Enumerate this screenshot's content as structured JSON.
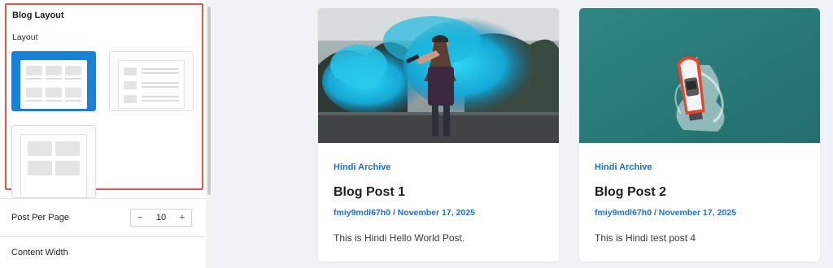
{
  "sidebar": {
    "section_title": "Blog Layout",
    "layout_label": "Layout",
    "layout_options": [
      "grid",
      "list",
      "masonry"
    ],
    "selected_layout": "grid",
    "post_per_page": {
      "label": "Post Per Page",
      "value": "10",
      "decrement": "−",
      "increment": "+"
    },
    "content_width": {
      "label": "Content Width"
    }
  },
  "posts": [
    {
      "category": "Hindi Archive",
      "title": "Blog Post 1",
      "meta": "fmiy9mdl67h0 / November 17, 2025",
      "excerpt": "This is Hindi Hello World Post.",
      "image": "woman-with-blue-smoke-photo"
    },
    {
      "category": "Hindi Archive",
      "title": "Blog Post 2",
      "meta": "fmiy9mdl67h0 / November 17, 2025",
      "excerpt": "This is Hindi test post 4",
      "image": "speedboat-aerial-photo"
    }
  ],
  "colors": {
    "accent": "#1a82d6",
    "link": "#1a6fd0",
    "highlight_border": "#e0584d",
    "page_bg": "#f0f2f6",
    "water": "#2a7f7c"
  }
}
